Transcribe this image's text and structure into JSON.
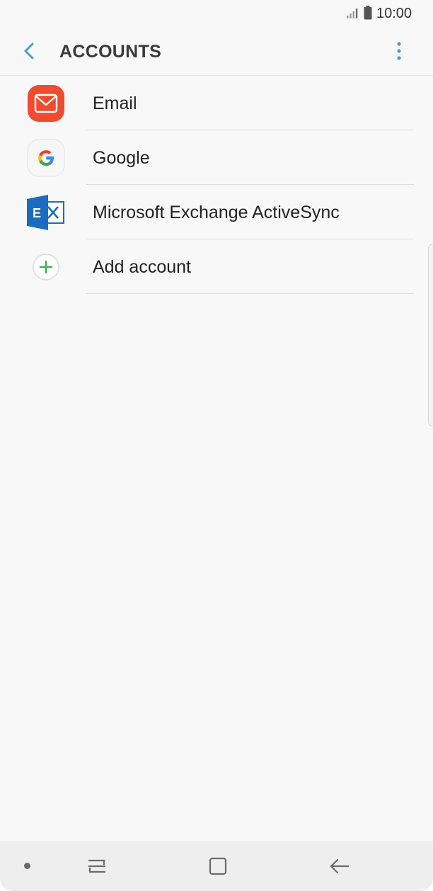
{
  "status_bar": {
    "time": "10:00",
    "icons": [
      "signal-icon",
      "battery-icon"
    ]
  },
  "app_bar": {
    "title": "ACCOUNTS",
    "back_icon": "chevron-left-icon",
    "more_icon": "more-vertical-icon",
    "accent_color": "#4a9ec9"
  },
  "accounts": [
    {
      "label": "Email",
      "icon": "email-icon",
      "icon_color": "#f04a2f"
    },
    {
      "label": "Google",
      "icon": "google-icon",
      "icon_color": "#4285f4"
    },
    {
      "label": "Microsoft Exchange ActiveSync",
      "icon": "exchange-icon",
      "icon_color": "#1a6cc0"
    },
    {
      "label": "Add account",
      "icon": "add-icon",
      "icon_color": "#3bb34a"
    }
  ],
  "nav_bar": {
    "icons": [
      "nav-dot-icon",
      "recent-apps-icon",
      "home-icon",
      "back-icon"
    ]
  }
}
